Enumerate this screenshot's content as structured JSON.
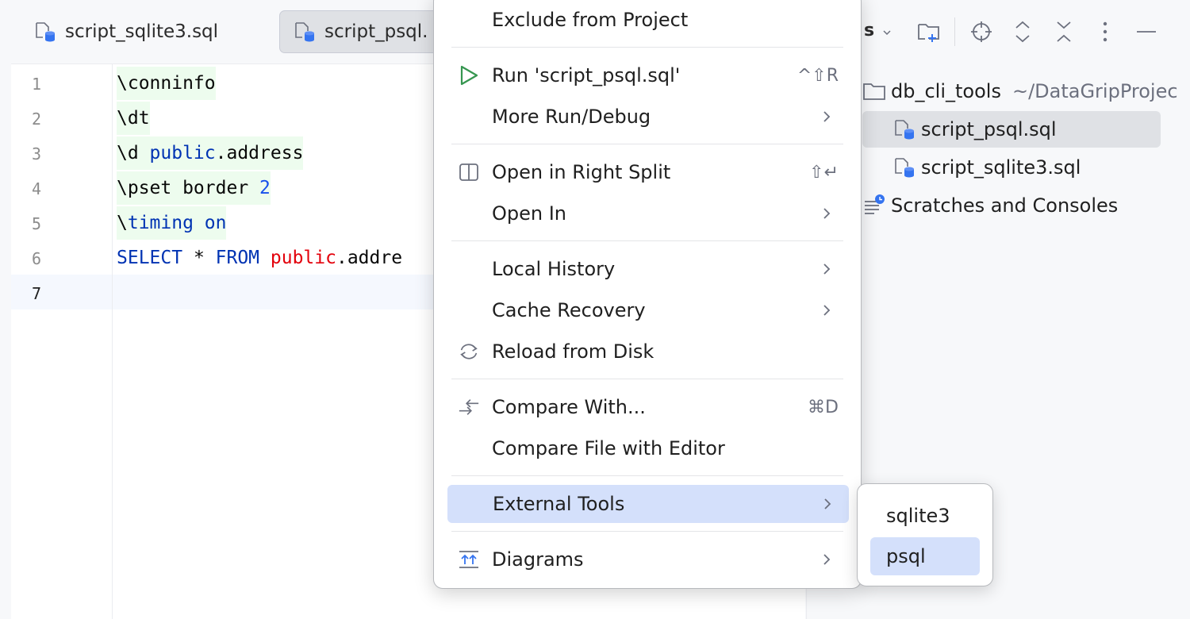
{
  "editor": {
    "tabs": [
      {
        "label": "script_sqlite3.sql"
      },
      {
        "label": "script_psql."
      }
    ],
    "line_numbers": [
      "1",
      "2",
      "3",
      "4",
      "5",
      "6",
      "7"
    ],
    "current_line": 7,
    "code": {
      "l1": "\\conninfo",
      "l2": "\\dt",
      "l3a": "\\d ",
      "l3b": "public",
      "l3c": ".address",
      "l4a": "\\pset border ",
      "l4b": "2",
      "l5a": "\\",
      "l5b": "timing on",
      "l6a": "SELECT",
      "l6b": " * ",
      "l6c": "FROM",
      "l6d": " ",
      "l6e": "public",
      "l6f": ".addre"
    }
  },
  "project": {
    "title_fragment": "s",
    "tree": {
      "root_label": "db_cli_tools",
      "root_path": "~/DataGripProjec",
      "file1": "script_psql.sql",
      "file2": "script_sqlite3.sql",
      "scratches": "Scratches and Consoles"
    }
  },
  "context_menu": {
    "items": {
      "exclude": "Exclude from Project",
      "run": "Run 'script_psql.sql'",
      "run_shortcut": "^⇧R",
      "more_run": "More Run/Debug",
      "open_right": "Open in Right Split",
      "open_right_shortcut": "⇧↵",
      "open_in": "Open In",
      "local_history": "Local History",
      "cache_recovery": "Cache Recovery",
      "reload": "Reload from Disk",
      "compare_with": "Compare With...",
      "compare_shortcut": "⌘D",
      "compare_editor": "Compare File with Editor",
      "external_tools": "External Tools",
      "diagrams": "Diagrams"
    }
  },
  "submenu": {
    "items": [
      "sqlite3",
      "psql"
    ],
    "active": "psql"
  },
  "colors": {
    "accent": "#3574f0",
    "selection": "#d4e0fb",
    "run_green": "#369650",
    "keyword": "#0033b3",
    "number": "#1750eb",
    "schema_red": "#e3000b"
  }
}
